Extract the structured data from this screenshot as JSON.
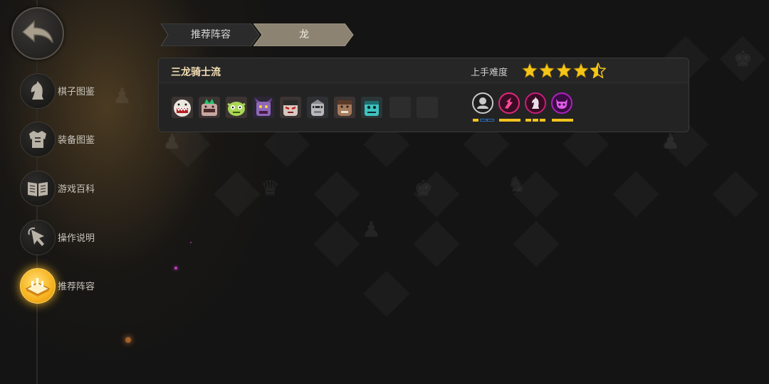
{
  "sidebar": {
    "back_icon": "back-arrow-icon",
    "items": [
      {
        "label": "棋子图鉴",
        "icon": "knight-icon",
        "active": false
      },
      {
        "label": "装备图鉴",
        "icon": "armor-icon",
        "active": false
      },
      {
        "label": "游戏百科",
        "icon": "book-icon",
        "active": false
      },
      {
        "label": "操作说明",
        "icon": "pointer-icon",
        "active": false
      },
      {
        "label": "推荐阵容",
        "icon": "chessboard-icon",
        "active": true
      }
    ]
  },
  "tabs": [
    {
      "label": "推荐阵容",
      "active": false
    },
    {
      "label": "龙",
      "active": true
    }
  ],
  "lineup": {
    "name": "三龙骑士流",
    "difficulty_label": "上手难度",
    "difficulty_stars": 4.5,
    "difficulty_max": 5,
    "champions": [
      {
        "icon": "white-beast-champion-icon",
        "color": "#e8e3da"
      },
      {
        "icon": "green-crown-beast-champion-icon",
        "color": "#c9a6a0"
      },
      {
        "icon": "green-goblin-champion-icon",
        "color": "#a9d656"
      },
      {
        "icon": "purple-demon-champion-icon",
        "color": "#8e68b8"
      },
      {
        "icon": "masked-warrior-champion-icon",
        "color": "#d8c8c0"
      },
      {
        "icon": "grey-knight-champion-icon",
        "color": "#b9b9bd"
      },
      {
        "icon": "brown-ogre-champion-icon",
        "color": "#a57a5c"
      },
      {
        "icon": "teal-zombie-champion-icon",
        "color": "#3fc3c0"
      },
      {
        "icon": "empty-slot",
        "color": "#2d2d2e"
      },
      {
        "icon": "empty-slot",
        "color": "#2d2d2e"
      }
    ],
    "traits": [
      {
        "icon": "knight-helmet-trait-icon",
        "color": "#c9c9c9",
        "level": 1,
        "max": 3
      },
      {
        "icon": "dragon-claw-trait-icon",
        "color": "#e0287a",
        "level": 1,
        "max": 1
      },
      {
        "icon": "knight-piece-trait-icon",
        "color": "#c81e7a",
        "level": 3,
        "max": 3
      },
      {
        "icon": "demon-skull-trait-icon",
        "color": "#b020c0",
        "level": 1,
        "max": 1
      }
    ],
    "colors": {
      "active_bar": "#f2c31f",
      "inactive_bar": "#1f4e8a",
      "star": "#f5c518"
    }
  }
}
